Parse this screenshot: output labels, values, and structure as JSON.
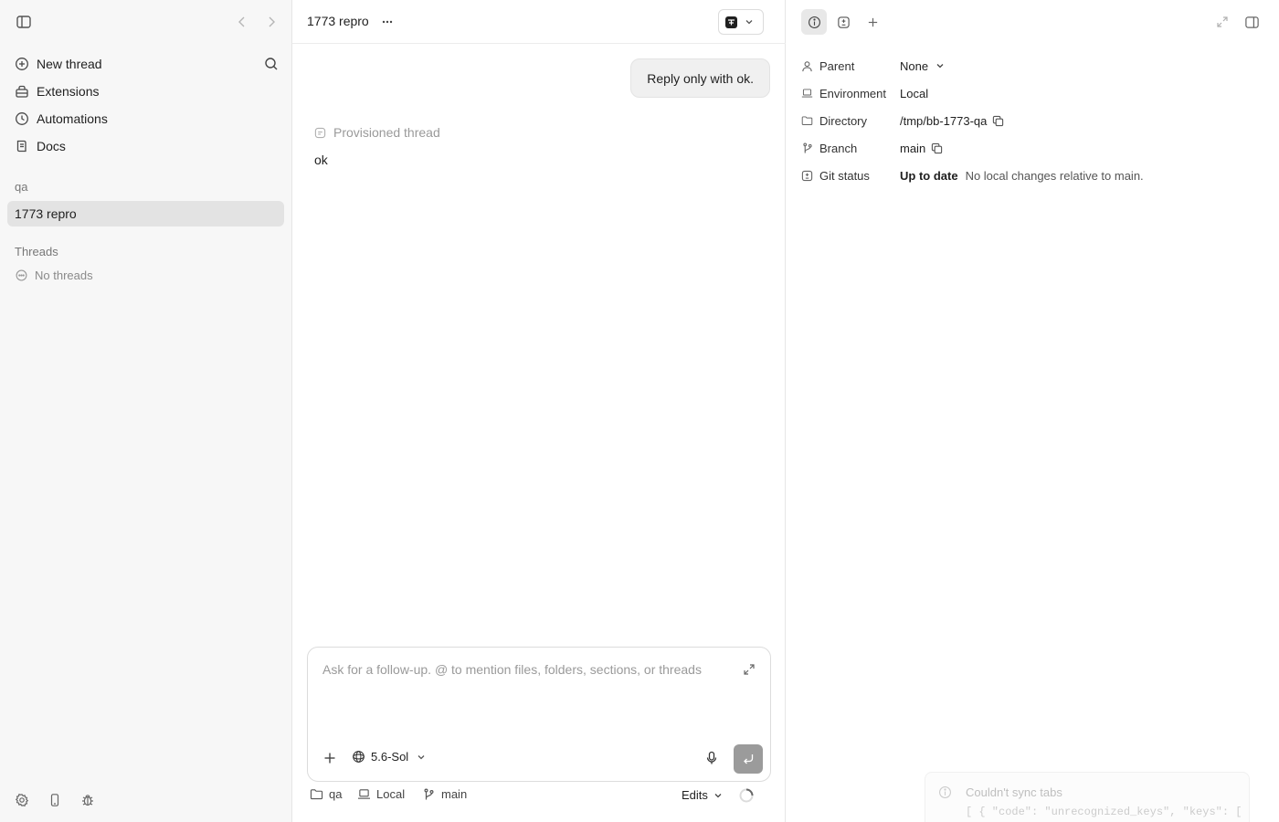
{
  "sidebar": {
    "nav": [
      {
        "label": "New thread",
        "icon": "new-thread-icon"
      },
      {
        "label": "Extensions",
        "icon": "extensions-icon"
      },
      {
        "label": "Automations",
        "icon": "clock-icon"
      },
      {
        "label": "Docs",
        "icon": "docs-icon"
      }
    ],
    "project_label": "qa",
    "active_thread": "1773 repro",
    "threads_label": "Threads",
    "no_threads": "No threads"
  },
  "main": {
    "title": "1773 repro",
    "user_message": "Reply only with ok.",
    "provisioned_label": "Provisioned thread",
    "reply": "ok",
    "composer": {
      "placeholder": "Ask for a follow-up. @ to mention files, folders, sections, or threads",
      "value": "",
      "model": "5.6-Sol"
    },
    "footer": {
      "folder": "qa",
      "environment": "Local",
      "branch": "main",
      "edits": "Edits"
    }
  },
  "details": {
    "rows": [
      {
        "key": "Parent",
        "value": "None"
      },
      {
        "key": "Environment",
        "value": "Local"
      },
      {
        "key": "Directory",
        "value": "/tmp/bb-1773-qa"
      },
      {
        "key": "Branch",
        "value": "main"
      },
      {
        "key": "Git status",
        "value": "Up to date",
        "description": "No local changes relative to main."
      }
    ]
  },
  "toast": {
    "title": "Couldn't sync tabs",
    "body": "[ { \"code\": \"unrecognized_keys\", \"keys\": ["
  },
  "colors": {
    "sidebar_bg": "#f7f7f7",
    "active_row": "#e3e3e3",
    "send_button": "#9b9b9b"
  }
}
